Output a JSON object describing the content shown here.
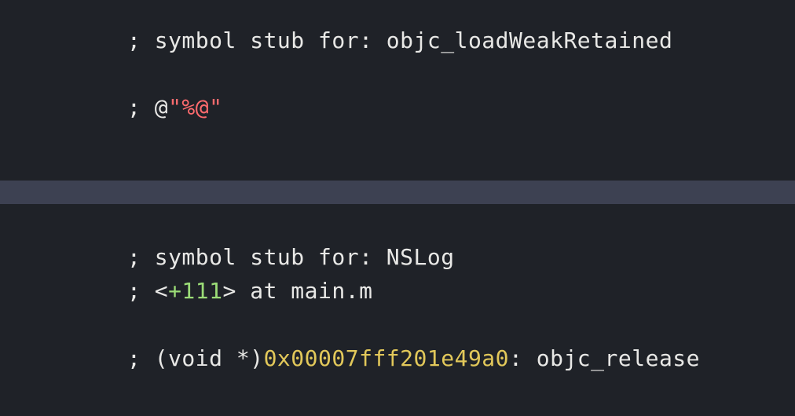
{
  "top": {
    "line1": {
      "prefix": "; ",
      "text": "symbol stub for: objc_loadWeakRetained"
    },
    "line2": {
      "prefix": "; ",
      "at": "@",
      "str": "\"%@\""
    }
  },
  "bottom": {
    "line1": {
      "prefix": "; ",
      "text": "symbol stub for: NSLog"
    },
    "line2": {
      "prefix": "; ",
      "lt": "<",
      "offset": "+111",
      "gt": ">",
      "rest": " at main.m"
    },
    "line3": {
      "prefix": "; ",
      "cast": "(void *)",
      "addr": "0x00007fff201e49a0",
      "rest": ": objc_release"
    }
  }
}
